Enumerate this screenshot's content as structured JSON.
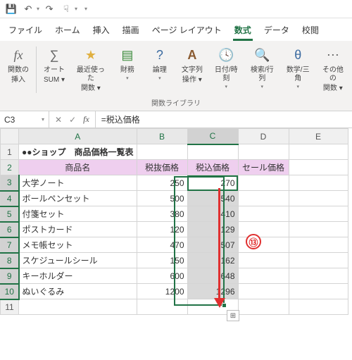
{
  "qat": {
    "save": "💾",
    "undo": "↶",
    "redo": "↷",
    "touch": "☟"
  },
  "tabs": {
    "file": "ファイル",
    "home": "ホーム",
    "insert": "挿入",
    "draw": "描画",
    "layout": "ページ レイアウト",
    "formulas": "数式",
    "data": "データ",
    "review": "校閲"
  },
  "ribbon": {
    "insert_fn_top": "関数の",
    "insert_fn_bot": "挿入",
    "autosum_top": "オート",
    "autosum_bot": "SUM ▾",
    "recent_top": "最近使った",
    "recent_bot": "関数 ▾",
    "financial": "財務",
    "logical": "論理",
    "text_top": "文字列",
    "text_bot": "操作 ▾",
    "datetime": "日付/時刻",
    "lookup": "検索/行列",
    "math": "数学/三角",
    "more_top": "その他の",
    "more_bot": "関数 ▾",
    "group": "関数ライブラリ"
  },
  "fbar": {
    "namebox": "C3",
    "cancel": "✕",
    "confirm": "✓",
    "fx": "fx",
    "formula": "=税込価格"
  },
  "cols": [
    "A",
    "B",
    "C",
    "D",
    "E"
  ],
  "rows": [
    "1",
    "2",
    "3",
    "4",
    "5",
    "6",
    "7",
    "8",
    "9",
    "10",
    "11"
  ],
  "title_cell": "●●ショップ　商品価格一覧表",
  "headers": {
    "name": "商品名",
    "extax": "税抜価格",
    "intax": "税込価格",
    "sale": "セール価格"
  },
  "items": [
    {
      "name": "大学ノート",
      "extax": "250",
      "intax": "270"
    },
    {
      "name": "ボールペンセット",
      "extax": "500",
      "intax": "540"
    },
    {
      "name": "付箋セット",
      "extax": "380",
      "intax": "410"
    },
    {
      "name": "ポストカード",
      "extax": "120",
      "intax": "129"
    },
    {
      "name": "メモ帳セット",
      "extax": "470",
      "intax": "507"
    },
    {
      "name": "スケジュールシール",
      "extax": "150",
      "intax": "162"
    },
    {
      "name": "キーホルダー",
      "extax": "600",
      "intax": "648"
    },
    {
      "name": "ぬいぐるみ",
      "extax": "1200",
      "intax": "1296"
    }
  ],
  "annotation": "⑬",
  "chart_data": {
    "type": "table",
    "title": "●●ショップ　商品価格一覧表",
    "columns": [
      "商品名",
      "税抜価格",
      "税込価格",
      "セール価格"
    ],
    "rows": [
      [
        "大学ノート",
        250,
        270,
        null
      ],
      [
        "ボールペンセット",
        500,
        540,
        null
      ],
      [
        "付箋セット",
        380,
        410,
        null
      ],
      [
        "ポストカード",
        120,
        129,
        null
      ],
      [
        "メモ帳セット",
        470,
        507,
        null
      ],
      [
        "スケジュールシール",
        150,
        162,
        null
      ],
      [
        "キーホルダー",
        600,
        648,
        null
      ],
      [
        "ぬいぐるみ",
        1200,
        1296,
        null
      ]
    ]
  }
}
